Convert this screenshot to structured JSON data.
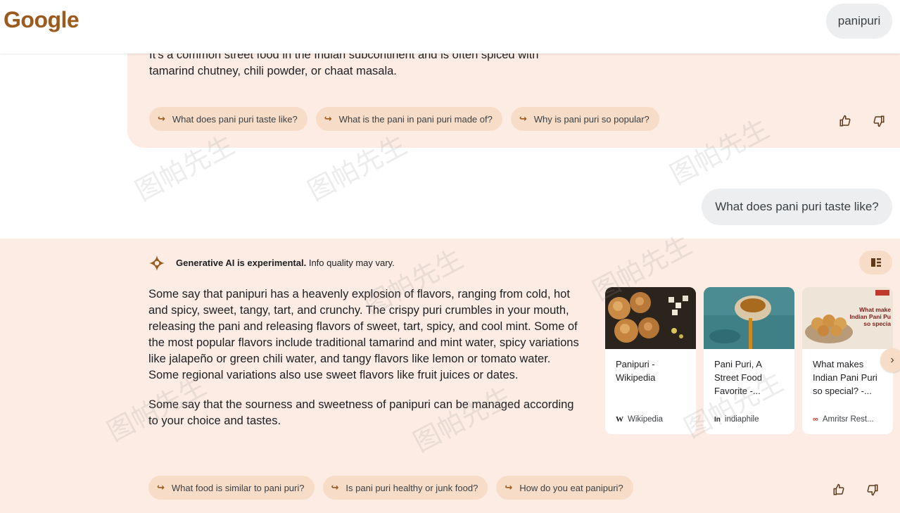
{
  "header": {
    "logo_text": "Google",
    "query": "panipuri"
  },
  "previous_answer": {
    "text_line1": "It's a common street food in the Indian subcontinent and is often spiced with",
    "text_line2": "tamarind chutney, chili powder, or chaat masala.",
    "followups": [
      "What does pani puri taste like?",
      "What is the pani in pani puri made of?",
      "Why is pani puri so popular?"
    ]
  },
  "user_question": "What does pani puri taste like?",
  "answer": {
    "disclaimer_bold": "Generative AI is experimental.",
    "disclaimer_rest": " Info quality may vary.",
    "paragraph1": "Some say that panipuri has a heavenly explosion of flavors, ranging from cold, hot and spicy, sweet, tangy, tart, and crunchy. The crispy puri crumbles in your mouth, releasing the pani and releasing flavors of sweet, tart, spicy, and cool mint. Some of the most popular flavors include traditional tamarind and mint water, spicy variations like jalapeño or green chili water, and tangy flavors like lemon or tomato water. Some regional variations also use sweet flavors like fruit juices or dates.",
    "paragraph2": "Some say that the sourness and sweetness of panipuri can be managed according to your choice and tastes.",
    "followups": [
      "What food is similar to pani puri?",
      "Is pani puri healthy or junk food?",
      "How do you eat panipuri?"
    ],
    "cards": [
      {
        "title": "Panipuri - Wikipedia",
        "source": "Wikipedia",
        "favicon": "W"
      },
      {
        "title": "Pani Puri, A Street Food Favorite -...",
        "source": "indiaphile",
        "favicon": "In"
      },
      {
        "title": "What makes Indian Pani Puri so special? -...",
        "source": "Amritsr Rest...",
        "favicon": "∞",
        "image_caption": "What make Indian Pani Pu so specia"
      }
    ]
  },
  "icons": {
    "followup_arrow": "↪",
    "thumbs_up": "thumbs-up-icon",
    "thumbs_down": "thumbs-down-icon",
    "next": "chevron-right-icon"
  },
  "watermark": "图帕先生",
  "colors": {
    "accent": "#9c5a1e",
    "panel_bg": "#fcece3",
    "chip_bg": "#f7dcc7"
  }
}
